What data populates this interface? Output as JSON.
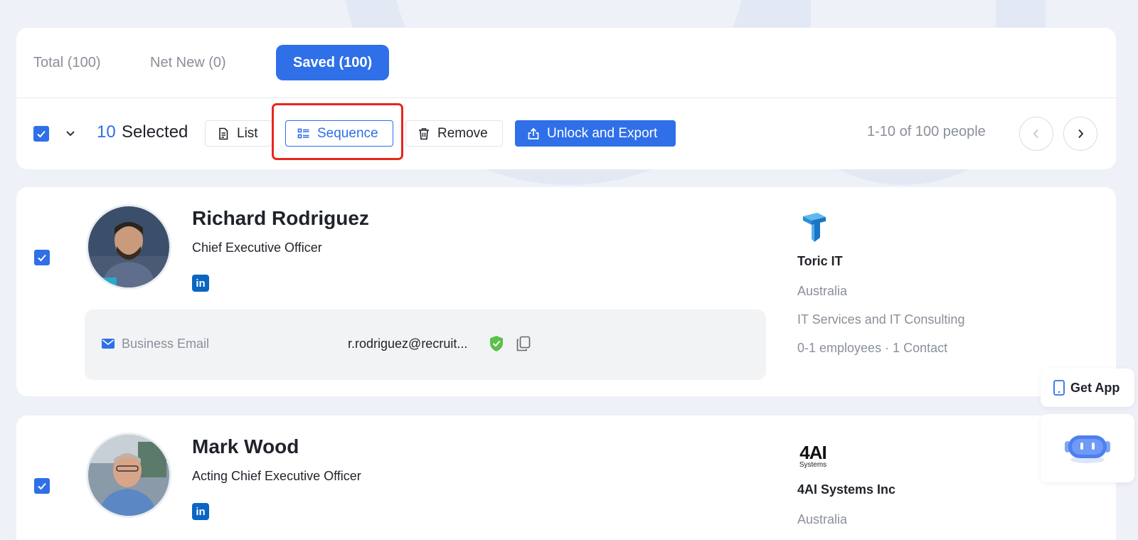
{
  "tabs": [
    {
      "label": "Total (100)"
    },
    {
      "label": "Net New (0)"
    },
    {
      "label": "Saved (100)"
    }
  ],
  "toolbar": {
    "selected_count": "10",
    "selected_label": "Selected",
    "list_label": "List",
    "sequence_label": "Sequence",
    "remove_label": "Remove",
    "export_label": "Unlock and Export",
    "pagination_text": "1-10 of 100 people"
  },
  "people": [
    {
      "name": "Richard Rodriguez",
      "title": "Chief Executive Officer",
      "email_label": "Business Email",
      "email_value": "r.rodriguez@recruit...",
      "company": {
        "name": "Toric IT",
        "country": "Australia",
        "industry": "IT Services and IT Consulting",
        "size": "0-1 employees · 1 Contact"
      }
    },
    {
      "name": "Mark Wood",
      "title": "Acting Chief Executive Officer",
      "company": {
        "name": "4AI Systems Inc",
        "logo_text": "4AI",
        "logo_subtext": "Systems",
        "country": "Australia"
      }
    }
  ],
  "floating": {
    "get_app_label": "Get App"
  },
  "colors": {
    "accent": "#2f6fe8",
    "highlight": "#e8271d",
    "linkedin": "#0a66c2",
    "verified": "#5cc04a"
  }
}
